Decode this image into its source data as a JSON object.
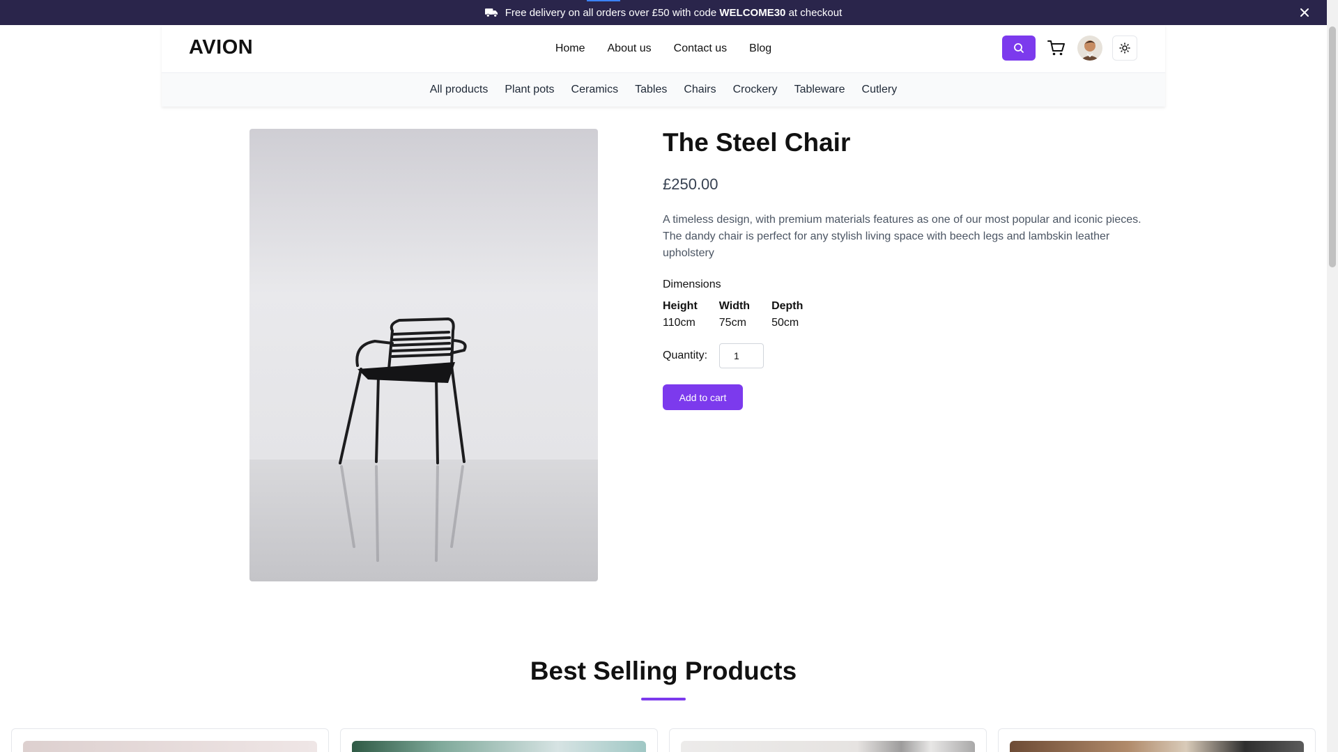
{
  "announcement": {
    "text_before": "Free delivery on all orders over £50 with code",
    "code": "WELCOME30",
    "text_after": "at checkout"
  },
  "header": {
    "logo": "AVION",
    "nav": [
      "Home",
      "About us",
      "Contact us",
      "Blog"
    ],
    "categories": [
      "All products",
      "Plant pots",
      "Ceramics",
      "Tables",
      "Chairs",
      "Crockery",
      "Tableware",
      "Cutlery"
    ]
  },
  "product": {
    "title": "The Steel Chair",
    "price": "£250.00",
    "description": "A timeless design, with premium materials features as one of our most popular and iconic pieces. The dandy chair is perfect for any stylish living space with beech legs and lambskin leather upholstery",
    "dimensions_label": "Dimensions",
    "dimensions": [
      {
        "label": "Height",
        "value": "110cm"
      },
      {
        "label": "Width",
        "value": "75cm"
      },
      {
        "label": "Depth",
        "value": "50cm"
      }
    ],
    "quantity_label": "Quantity:",
    "quantity": "1",
    "add_to_cart": "Add to cart"
  },
  "best_selling": {
    "title": "Best Selling Products"
  },
  "colors": {
    "accent": "#7c3aed",
    "announcement_bg": "#2a254b"
  },
  "icons": [
    "truck-icon",
    "close-icon",
    "search-icon",
    "cart-icon",
    "avatar",
    "sun-icon"
  ]
}
